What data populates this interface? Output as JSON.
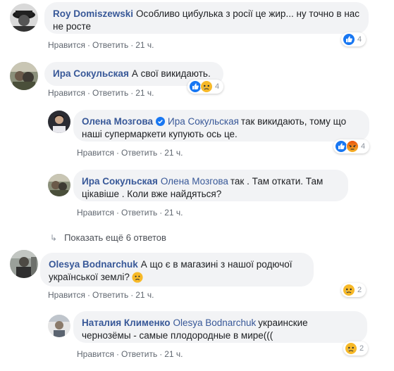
{
  "comments": [
    {
      "author": "Roy Domiszewski",
      "mention": "",
      "text": "Особливо цибулька з росії це жир... ну точно в нас не росте",
      "actions": {
        "like": "Нравится",
        "reply": "Ответить",
        "time": "21 ч."
      },
      "reactions": {
        "icons": [
          "like"
        ],
        "count": "4"
      }
    },
    {
      "author": "Ира Сокульская",
      "mention": "",
      "text": "А свої викидають.",
      "actions": {
        "like": "Нравится",
        "reply": "Ответить",
        "time": "21 ч."
      },
      "reactions": {
        "icons": [
          "like",
          "sad"
        ],
        "count": "4"
      }
    },
    {
      "author": "Олена Мозгова",
      "mention": "Ира Сокульская",
      "text": "так викидають, тому що наші супермаркети купують ось це.",
      "actions": {
        "like": "Нравится",
        "reply": "Ответить",
        "time": "21 ч."
      },
      "reactions": {
        "icons": [
          "like",
          "angry"
        ],
        "count": "4"
      }
    },
    {
      "author": "Ира Сокульская",
      "mention": "Олена Мозгова",
      "text": "так . Там откати. Там цікавіше . Коли вже найдяться?",
      "actions": {
        "like": "Нравится",
        "reply": "Ответить",
        "time": "21 ч."
      },
      "reactions": null
    },
    {
      "author": "Olesya Bodnarchuk",
      "mention": "",
      "text": "А що є в магазині з нашої родючої української землі?",
      "actions": {
        "like": "Нравится",
        "reply": "Ответить",
        "time": "21 ч."
      },
      "reactions": {
        "icons": [
          "sad"
        ],
        "count": "2"
      }
    },
    {
      "author": "Наталия Клименко",
      "mention": "Olesya Bodnarchuk",
      "text": "украинские чернозёмы - самые плодородные в мире(((",
      "actions": {
        "like": "Нравится",
        "reply": "Ответить",
        "time": "21 ч."
      },
      "reactions": {
        "icons": [
          "sad"
        ],
        "count": "2"
      }
    }
  ],
  "show_more": "Показать ещё 6 ответов",
  "colors": {
    "link": "#385898",
    "bubble": "#f2f3f5",
    "meta": "#606770",
    "like_blue": "#1877f2",
    "reaction_yellow": "#f7b928",
    "angry_red": "#e9710f"
  }
}
